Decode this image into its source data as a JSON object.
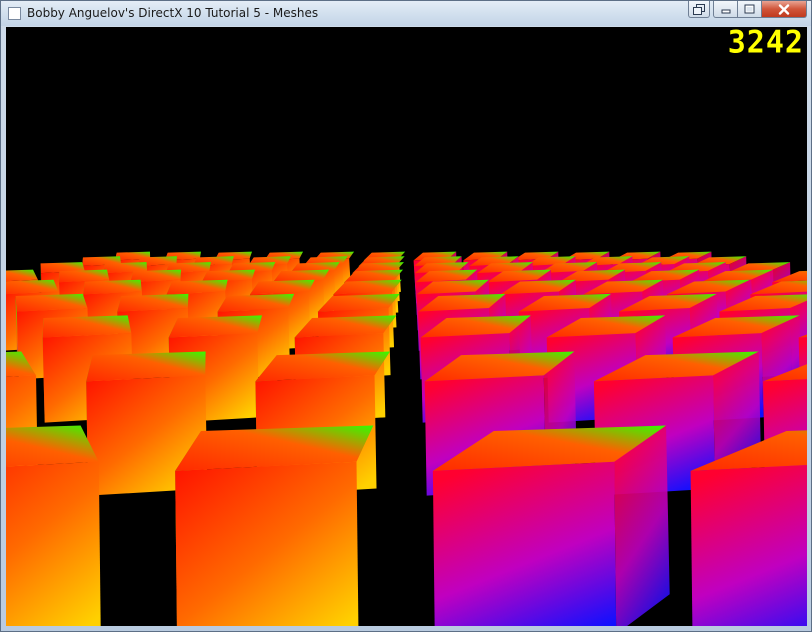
{
  "window": {
    "title": "Bobby Anguelov's DirectX 10 Tutorial 5 - Meshes",
    "buttons": {
      "extra": "restore-icon",
      "minimize": "minimize-icon",
      "maximize": "maximize-icon",
      "close": "close-icon"
    }
  },
  "viewport": {
    "fps_counter": "3242",
    "background_color": "#000000",
    "counter_color": "#ffff00",
    "mesh": "cube",
    "cube_face_colors": [
      "#ff0000",
      "#00ff00",
      "#0000ff",
      "#ffff00"
    ]
  }
}
